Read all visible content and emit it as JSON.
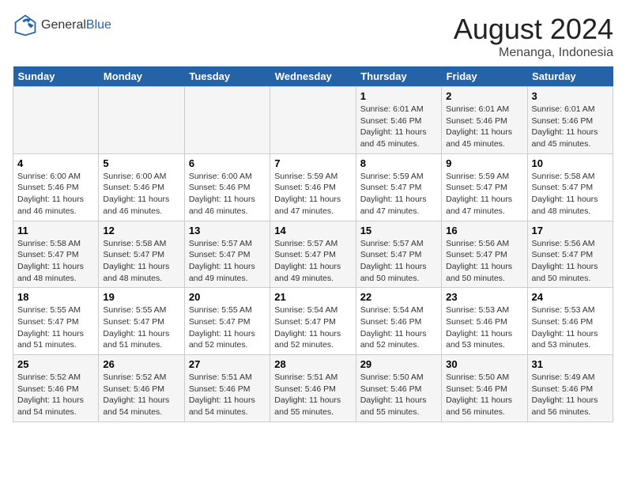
{
  "header": {
    "logo_general": "General",
    "logo_blue": "Blue",
    "main_title": "August 2024",
    "subtitle": "Menanga, Indonesia"
  },
  "weekdays": [
    "Sunday",
    "Monday",
    "Tuesday",
    "Wednesday",
    "Thursday",
    "Friday",
    "Saturday"
  ],
  "weeks": [
    [
      {
        "day": "",
        "info": ""
      },
      {
        "day": "",
        "info": ""
      },
      {
        "day": "",
        "info": ""
      },
      {
        "day": "",
        "info": ""
      },
      {
        "day": "1",
        "info": "Sunrise: 6:01 AM\nSunset: 5:46 PM\nDaylight: 11 hours and 45 minutes."
      },
      {
        "day": "2",
        "info": "Sunrise: 6:01 AM\nSunset: 5:46 PM\nDaylight: 11 hours and 45 minutes."
      },
      {
        "day": "3",
        "info": "Sunrise: 6:01 AM\nSunset: 5:46 PM\nDaylight: 11 hours and 45 minutes."
      }
    ],
    [
      {
        "day": "4",
        "info": "Sunrise: 6:00 AM\nSunset: 5:46 PM\nDaylight: 11 hours and 46 minutes."
      },
      {
        "day": "5",
        "info": "Sunrise: 6:00 AM\nSunset: 5:46 PM\nDaylight: 11 hours and 46 minutes."
      },
      {
        "day": "6",
        "info": "Sunrise: 6:00 AM\nSunset: 5:46 PM\nDaylight: 11 hours and 46 minutes."
      },
      {
        "day": "7",
        "info": "Sunrise: 5:59 AM\nSunset: 5:46 PM\nDaylight: 11 hours and 47 minutes."
      },
      {
        "day": "8",
        "info": "Sunrise: 5:59 AM\nSunset: 5:47 PM\nDaylight: 11 hours and 47 minutes."
      },
      {
        "day": "9",
        "info": "Sunrise: 5:59 AM\nSunset: 5:47 PM\nDaylight: 11 hours and 47 minutes."
      },
      {
        "day": "10",
        "info": "Sunrise: 5:58 AM\nSunset: 5:47 PM\nDaylight: 11 hours and 48 minutes."
      }
    ],
    [
      {
        "day": "11",
        "info": "Sunrise: 5:58 AM\nSunset: 5:47 PM\nDaylight: 11 hours and 48 minutes."
      },
      {
        "day": "12",
        "info": "Sunrise: 5:58 AM\nSunset: 5:47 PM\nDaylight: 11 hours and 48 minutes."
      },
      {
        "day": "13",
        "info": "Sunrise: 5:57 AM\nSunset: 5:47 PM\nDaylight: 11 hours and 49 minutes."
      },
      {
        "day": "14",
        "info": "Sunrise: 5:57 AM\nSunset: 5:47 PM\nDaylight: 11 hours and 49 minutes."
      },
      {
        "day": "15",
        "info": "Sunrise: 5:57 AM\nSunset: 5:47 PM\nDaylight: 11 hours and 50 minutes."
      },
      {
        "day": "16",
        "info": "Sunrise: 5:56 AM\nSunset: 5:47 PM\nDaylight: 11 hours and 50 minutes."
      },
      {
        "day": "17",
        "info": "Sunrise: 5:56 AM\nSunset: 5:47 PM\nDaylight: 11 hours and 50 minutes."
      }
    ],
    [
      {
        "day": "18",
        "info": "Sunrise: 5:55 AM\nSunset: 5:47 PM\nDaylight: 11 hours and 51 minutes."
      },
      {
        "day": "19",
        "info": "Sunrise: 5:55 AM\nSunset: 5:47 PM\nDaylight: 11 hours and 51 minutes."
      },
      {
        "day": "20",
        "info": "Sunrise: 5:55 AM\nSunset: 5:47 PM\nDaylight: 11 hours and 52 minutes."
      },
      {
        "day": "21",
        "info": "Sunrise: 5:54 AM\nSunset: 5:47 PM\nDaylight: 11 hours and 52 minutes."
      },
      {
        "day": "22",
        "info": "Sunrise: 5:54 AM\nSunset: 5:46 PM\nDaylight: 11 hours and 52 minutes."
      },
      {
        "day": "23",
        "info": "Sunrise: 5:53 AM\nSunset: 5:46 PM\nDaylight: 11 hours and 53 minutes."
      },
      {
        "day": "24",
        "info": "Sunrise: 5:53 AM\nSunset: 5:46 PM\nDaylight: 11 hours and 53 minutes."
      }
    ],
    [
      {
        "day": "25",
        "info": "Sunrise: 5:52 AM\nSunset: 5:46 PM\nDaylight: 11 hours and 54 minutes."
      },
      {
        "day": "26",
        "info": "Sunrise: 5:52 AM\nSunset: 5:46 PM\nDaylight: 11 hours and 54 minutes."
      },
      {
        "day": "27",
        "info": "Sunrise: 5:51 AM\nSunset: 5:46 PM\nDaylight: 11 hours and 54 minutes."
      },
      {
        "day": "28",
        "info": "Sunrise: 5:51 AM\nSunset: 5:46 PM\nDaylight: 11 hours and 55 minutes."
      },
      {
        "day": "29",
        "info": "Sunrise: 5:50 AM\nSunset: 5:46 PM\nDaylight: 11 hours and 55 minutes."
      },
      {
        "day": "30",
        "info": "Sunrise: 5:50 AM\nSunset: 5:46 PM\nDaylight: 11 hours and 56 minutes."
      },
      {
        "day": "31",
        "info": "Sunrise: 5:49 AM\nSunset: 5:46 PM\nDaylight: 11 hours and 56 minutes."
      }
    ]
  ]
}
